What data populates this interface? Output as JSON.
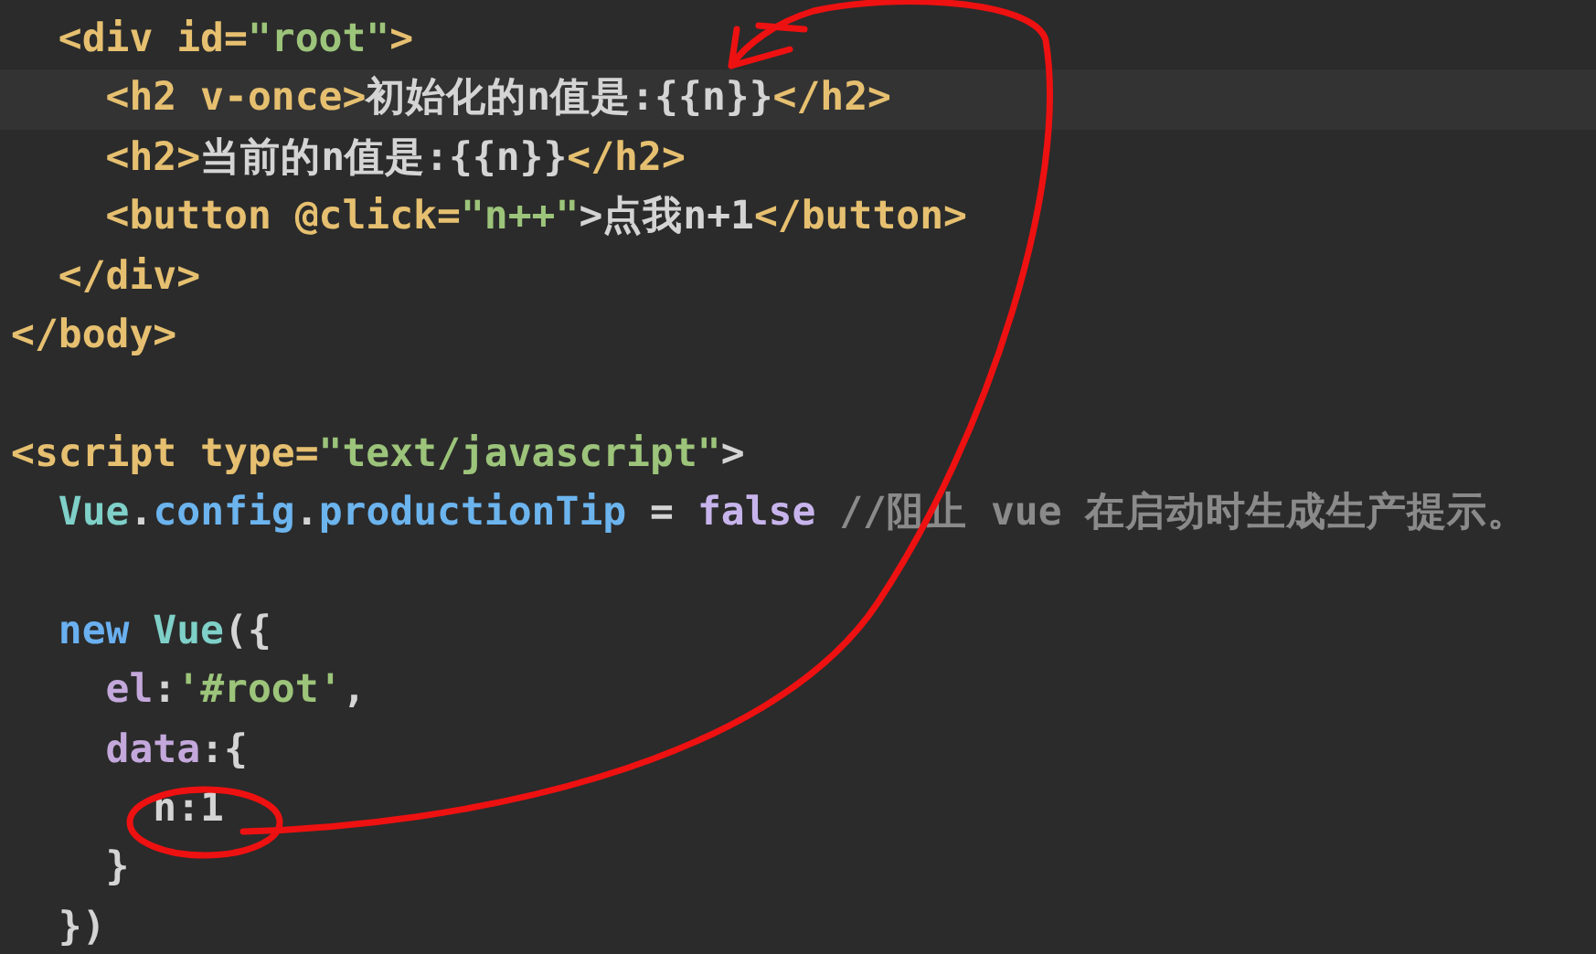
{
  "editor": {
    "lines": [
      {
        "kind": "code",
        "highlighted": false,
        "tokens": [
          {
            "text": "  <div id=",
            "kind": "tag"
          },
          {
            "text": "\"root\"",
            "kind": "string"
          },
          {
            "text": ">",
            "kind": "tag"
          }
        ]
      },
      {
        "kind": "code",
        "highlighted": true,
        "tokens": [
          {
            "text": "    <h2 v-once>",
            "kind": "tag"
          },
          {
            "text": "初始化的n值是:{{n}}",
            "kind": "plain"
          },
          {
            "text": "</h2>",
            "kind": "tag"
          }
        ]
      },
      {
        "kind": "code",
        "highlighted": false,
        "tokens": [
          {
            "text": "    <h2>",
            "kind": "tag"
          },
          {
            "text": "当前的n值是:{{n}}",
            "kind": "plain"
          },
          {
            "text": "</h2>",
            "kind": "tag"
          }
        ]
      },
      {
        "kind": "code",
        "highlighted": false,
        "tokens": [
          {
            "text": "    <button @click=",
            "kind": "tag"
          },
          {
            "text": "\"n++\"",
            "kind": "string"
          },
          {
            "text": ">点我n+1",
            "kind": "plain"
          },
          {
            "text": "</button>",
            "kind": "tag"
          }
        ]
      },
      {
        "kind": "code",
        "highlighted": false,
        "tokens": [
          {
            "text": "  </div>",
            "kind": "tag"
          }
        ]
      },
      {
        "kind": "code",
        "highlighted": false,
        "tokens": [
          {
            "text": "</body>",
            "kind": "tag"
          }
        ]
      },
      {
        "kind": "blank"
      },
      {
        "kind": "code",
        "highlighted": false,
        "tokens": [
          {
            "text": "<script type=",
            "kind": "tag"
          },
          {
            "text": "\"text/javascript\"",
            "kind": "string"
          },
          {
            "text": ">",
            "kind": "plain"
          }
        ]
      },
      {
        "kind": "code",
        "highlighted": false,
        "tokens": [
          {
            "text": "  Vue",
            "kind": "class"
          },
          {
            "text": ".",
            "kind": "plain"
          },
          {
            "text": "config",
            "kind": "property"
          },
          {
            "text": ".",
            "kind": "plain"
          },
          {
            "text": "productionTip",
            "kind": "property"
          },
          {
            "text": " = ",
            "kind": "plain"
          },
          {
            "text": "false",
            "kind": "literal"
          },
          {
            "text": " //阻止 vue 在启动时生成生产提示。",
            "kind": "comment"
          }
        ]
      },
      {
        "kind": "blank"
      },
      {
        "kind": "code",
        "highlighted": false,
        "tokens": [
          {
            "text": "  new ",
            "kind": "keyword"
          },
          {
            "text": "Vue",
            "kind": "class"
          },
          {
            "text": "({",
            "kind": "plain"
          }
        ]
      },
      {
        "kind": "code",
        "highlighted": false,
        "tokens": [
          {
            "text": "    el",
            "kind": "key"
          },
          {
            "text": ":",
            "kind": "plain"
          },
          {
            "text": "'#root'",
            "kind": "string"
          },
          {
            "text": ",",
            "kind": "plain"
          }
        ]
      },
      {
        "kind": "code",
        "highlighted": false,
        "tokens": [
          {
            "text": "    data",
            "kind": "key"
          },
          {
            "text": ":{",
            "kind": "plain"
          }
        ]
      },
      {
        "kind": "code",
        "highlighted": false,
        "tokens": [
          {
            "text": "      n:1",
            "kind": "plain"
          }
        ]
      },
      {
        "kind": "code",
        "highlighted": false,
        "tokens": [
          {
            "text": "    }",
            "kind": "plain"
          }
        ]
      },
      {
        "kind": "code",
        "highlighted": false,
        "tokens": [
          {
            "text": "  })",
            "kind": "plain"
          }
        ]
      }
    ]
  }
}
